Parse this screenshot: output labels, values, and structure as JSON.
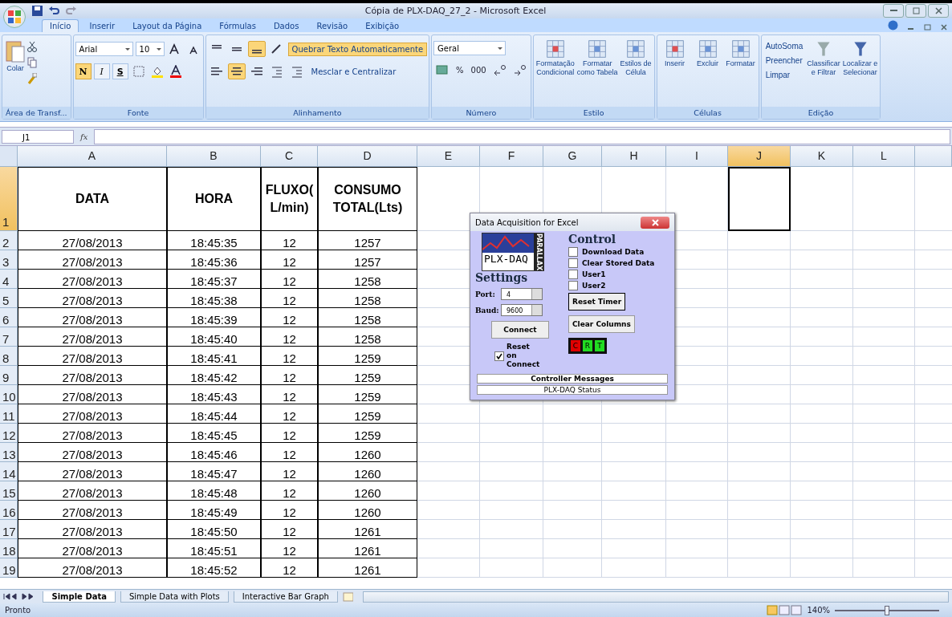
{
  "window": {
    "title": "Cópia de PLX-DAQ_27_2 - Microsoft Excel"
  },
  "ribbon": {
    "tabs": [
      {
        "label": "Início",
        "selected": true
      },
      {
        "label": "Inserir",
        "selected": false
      },
      {
        "label": "Layout da Página",
        "selected": false
      },
      {
        "label": "Fórmulas",
        "selected": false
      },
      {
        "label": "Dados",
        "selected": false
      },
      {
        "label": "Revisão",
        "selected": false
      },
      {
        "label": "Exibição",
        "selected": false
      }
    ],
    "groups": [
      {
        "kind": "clipboard",
        "label": "Área de Transf...",
        "paste": "Colar"
      },
      {
        "kind": "font",
        "label": "Fonte",
        "font": "Arial",
        "size": "10",
        "styles": [
          {
            "text": "N",
            "on": true
          },
          {
            "text": "I",
            "on": false
          },
          {
            "text": "S",
            "on": false
          }
        ]
      },
      {
        "kind": "alignment",
        "label": "Alinhamento",
        "wrap": "Quebrar Texto Automaticamente",
        "wrap_on": true,
        "merge": "Mesclar e Centralizar",
        "align": [
          {
            "on": false
          },
          {
            "on": false
          },
          {
            "on": true
          },
          {
            "on": false
          },
          {
            "on": true
          },
          {
            "on": false
          }
        ]
      },
      {
        "kind": "number",
        "label": "Número",
        "format": "Geral",
        "buttons": [
          "%",
          "000"
        ]
      },
      {
        "kind": "big",
        "label": "Estilo",
        "buttons": [
          {
            "line1": "Formatação",
            "line2": "Condicional"
          },
          {
            "line1": "Formatar",
            "line2": "como Tabela"
          },
          {
            "line1": "Estilos de",
            "line2": "Célula"
          }
        ]
      },
      {
        "kind": "big",
        "label": "Células",
        "buttons": [
          {
            "line1": "Inserir"
          },
          {
            "line1": "Excluir"
          },
          {
            "line1": "Formatar"
          }
        ]
      },
      {
        "kind": "editing",
        "label": "Edição",
        "small": [
          "AutoSoma",
          "Preencher",
          "Limpar"
        ],
        "buttons": [
          {
            "line1": "Classificar",
            "line2": "e Filtrar"
          },
          {
            "line1": "Localizar e",
            "line2": "Selecionar"
          }
        ]
      }
    ]
  },
  "formula_bar": {
    "name_box": "J1",
    "fx": "fx"
  },
  "sheet": {
    "columns": [
      {
        "label": "A",
        "selected": false
      },
      {
        "label": "B",
        "selected": false
      },
      {
        "label": "C",
        "selected": false
      },
      {
        "label": "D",
        "selected": false
      },
      {
        "label": "E",
        "selected": false
      },
      {
        "label": "F",
        "selected": false
      },
      {
        "label": "G",
        "selected": false
      },
      {
        "label": "H",
        "selected": false
      },
      {
        "label": "I",
        "selected": false
      },
      {
        "label": "J",
        "selected": true
      },
      {
        "label": "K",
        "selected": false
      },
      {
        "label": "L",
        "selected": false
      }
    ],
    "header_row": {
      "number": "1",
      "selected": true,
      "cells": [
        "DATA",
        "HORA",
        "FLUXO( L/min)",
        "CONSUMO TOTAL(Lts)"
      ]
    },
    "rows": [
      {
        "number": "2",
        "cells": [
          "27/08/2013",
          "18:45:35",
          "12",
          "1257"
        ]
      },
      {
        "number": "3",
        "cells": [
          "27/08/2013",
          "18:45:36",
          "12",
          "1257"
        ]
      },
      {
        "number": "4",
        "cells": [
          "27/08/2013",
          "18:45:37",
          "12",
          "1258"
        ]
      },
      {
        "number": "5",
        "cells": [
          "27/08/2013",
          "18:45:38",
          "12",
          "1258"
        ]
      },
      {
        "number": "6",
        "cells": [
          "27/08/2013",
          "18:45:39",
          "12",
          "1258"
        ]
      },
      {
        "number": "7",
        "cells": [
          "27/08/2013",
          "18:45:40",
          "12",
          "1258"
        ]
      },
      {
        "number": "8",
        "cells": [
          "27/08/2013",
          "18:45:41",
          "12",
          "1259"
        ]
      },
      {
        "number": "9",
        "cells": [
          "27/08/2013",
          "18:45:42",
          "12",
          "1259"
        ]
      },
      {
        "number": "10",
        "cells": [
          "27/08/2013",
          "18:45:43",
          "12",
          "1259"
        ]
      },
      {
        "number": "11",
        "cells": [
          "27/08/2013",
          "18:45:44",
          "12",
          "1259"
        ]
      },
      {
        "number": "12",
        "cells": [
          "27/08/2013",
          "18:45:45",
          "12",
          "1259"
        ]
      },
      {
        "number": "13",
        "cells": [
          "27/08/2013",
          "18:45:46",
          "12",
          "1260"
        ]
      },
      {
        "number": "14",
        "cells": [
          "27/08/2013",
          "18:45:47",
          "12",
          "1260"
        ]
      },
      {
        "number": "15",
        "cells": [
          "27/08/2013",
          "18:45:48",
          "12",
          "1260"
        ]
      },
      {
        "number": "16",
        "cells": [
          "27/08/2013",
          "18:45:49",
          "12",
          "1260"
        ]
      },
      {
        "number": "17",
        "cells": [
          "27/08/2013",
          "18:45:50",
          "12",
          "1261"
        ]
      },
      {
        "number": "18",
        "cells": [
          "27/08/2013",
          "18:45:51",
          "12",
          "1261"
        ]
      },
      {
        "number": "19",
        "cells": [
          "27/08/2013",
          "18:45:52",
          "12",
          "1261"
        ]
      }
    ]
  },
  "dialog": {
    "title": "Data Acquisition for Excel",
    "logo": "PLX-DAQ",
    "logo_side": "PARALLAX",
    "settings": "Settings",
    "port_label": "Port:",
    "port": "4",
    "baud_label": "Baud:",
    "baud": "9600",
    "connect": "Connect",
    "reset_on_connect": {
      "label": "Reset on Connect",
      "checked": true
    },
    "control": "Control",
    "checkboxes": [
      {
        "label": "Download Data",
        "checked": false
      },
      {
        "label": "Clear Stored Data",
        "checked": false
      },
      {
        "label": "User1",
        "checked": false
      },
      {
        "label": "User2",
        "checked": false
      }
    ],
    "reset_timer": "Reset Timer",
    "clear_columns": "Clear Columns",
    "indicators": [
      {
        "label": "C",
        "color": "#e00000"
      },
      {
        "label": "R",
        "color": "#22dd22"
      },
      {
        "label": "T",
        "color": "#22dd22"
      }
    ],
    "messages": "Controller Messages",
    "status": "PLX-DAQ Status"
  },
  "sheet_tabs": [
    {
      "label": "Simple Data",
      "selected": true
    },
    {
      "label": "Simple Data with Plots",
      "selected": false
    },
    {
      "label": "Interactive Bar Graph",
      "selected": false
    }
  ],
  "status_bar": {
    "text": "Pronto",
    "zoom": "140%",
    "level": 0.5
  }
}
